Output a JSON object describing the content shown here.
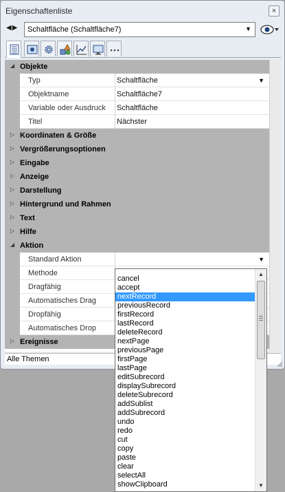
{
  "window": {
    "title": "Eigenschaftenliste",
    "close_label": "×"
  },
  "object_select": {
    "value": "Schaltfläche (Schaltfläche7)"
  },
  "tabs": [
    {
      "icon": "property-list-icon",
      "active": true
    },
    {
      "icon": "object-icon",
      "active": false
    },
    {
      "icon": "gear-icon",
      "active": false
    },
    {
      "icon": "shapes-icon",
      "active": false
    },
    {
      "icon": "chart-icon",
      "active": false
    },
    {
      "icon": "monitor-icon",
      "active": false
    },
    {
      "icon": "more-icon",
      "active": false
    }
  ],
  "grid": {
    "categories": {
      "objekte": "Objekte",
      "koordinaten": "Koordinaten & Größe",
      "vergroesserung": "Vergrößerungsoptionen",
      "eingabe": "Eingabe",
      "anzeige": "Anzeige",
      "darstellung": "Darstellung",
      "hintergrund": "Hintergrund und Rahmen",
      "text": "Text",
      "hilfe": "Hilfe",
      "aktion": "Aktion",
      "ereignisse": "Ereignisse"
    },
    "objekte_props": [
      {
        "name": "Typ",
        "value": "Schaltfläche"
      },
      {
        "name": "Objektname",
        "value": "Schaltfläche7"
      },
      {
        "name": "Variable oder Ausdruck",
        "value": "Schaltfläche"
      },
      {
        "name": "Titel",
        "value": "Nächster"
      }
    ],
    "aktion_props": [
      {
        "name": "Standard Aktion",
        "value": ""
      },
      {
        "name": "Methode",
        "value": ""
      },
      {
        "name": "Dragfähig",
        "value": ""
      },
      {
        "name": "Automatisches Drag",
        "value": ""
      },
      {
        "name": "Dropfähig",
        "value": ""
      },
      {
        "name": "Automatisches Drop",
        "value": ""
      }
    ]
  },
  "status_bar": {
    "text": "Alle Themen"
  },
  "dropdown": {
    "selected": "nextRecord",
    "items": [
      "cancel",
      "accept",
      "nextRecord",
      "previousRecord",
      "firstRecord",
      "lastRecord",
      "deleteRecord",
      "nextPage",
      "previousPage",
      "firstPage",
      "lastPage",
      "editSubrecord",
      "displaySubrecord",
      "deleteSubrecord",
      "addSublist",
      "addSubrecord",
      "undo",
      "redo",
      "cut",
      "copy",
      "paste",
      "clear",
      "selectAll",
      "showClipboard"
    ]
  },
  "colors": {
    "selection": "#3399ff",
    "category_band": "#b4b4b4",
    "panel": "#e8edf4"
  }
}
